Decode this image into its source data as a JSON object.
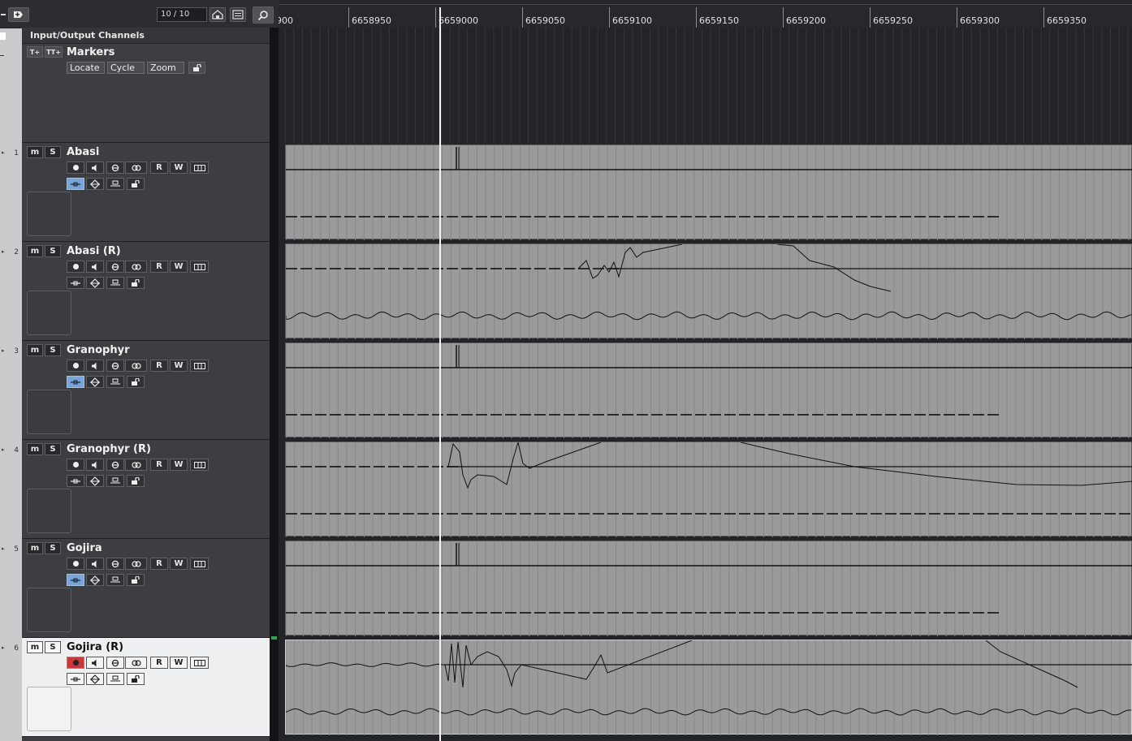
{
  "toolbar": {
    "counter": "10 / 10"
  },
  "io_channels": {
    "label": "Input/Output Channels"
  },
  "markers": {
    "name": "Markers",
    "buttons": [
      "Locate",
      "Cycle",
      "Zoom"
    ]
  },
  "track_buttons": {
    "mute": "m",
    "solo": "S",
    "read": "R",
    "write": "W"
  },
  "tracks": [
    {
      "num": "1",
      "name": "Abasi",
      "selected": false,
      "record": false,
      "mode_active": true
    },
    {
      "num": "2",
      "name": "Abasi (R)",
      "selected": false,
      "record": false,
      "mode_active": false
    },
    {
      "num": "3",
      "name": "Granophyr",
      "selected": false,
      "record": false,
      "mode_active": true
    },
    {
      "num": "4",
      "name": "Granophyr (R)",
      "selected": false,
      "record": false,
      "mode_active": false
    },
    {
      "num": "5",
      "name": "Gojira",
      "selected": false,
      "record": false,
      "mode_active": true
    },
    {
      "num": "6",
      "name": "Gojira (R)",
      "selected": true,
      "record": true,
      "mode_active": false
    }
  ],
  "ruler": {
    "labels": [
      "900",
      "6658950",
      "6659000",
      "6659050",
      "6659100",
      "6659150",
      "6659200",
      "6659250",
      "6659300",
      "6659350"
    ]
  },
  "colors": {
    "lane_bg": "#9a9a9a",
    "active_blue": "#7aa4d6",
    "record_red": "#c9393c",
    "selected_track_bg": "#eeeff0"
  }
}
